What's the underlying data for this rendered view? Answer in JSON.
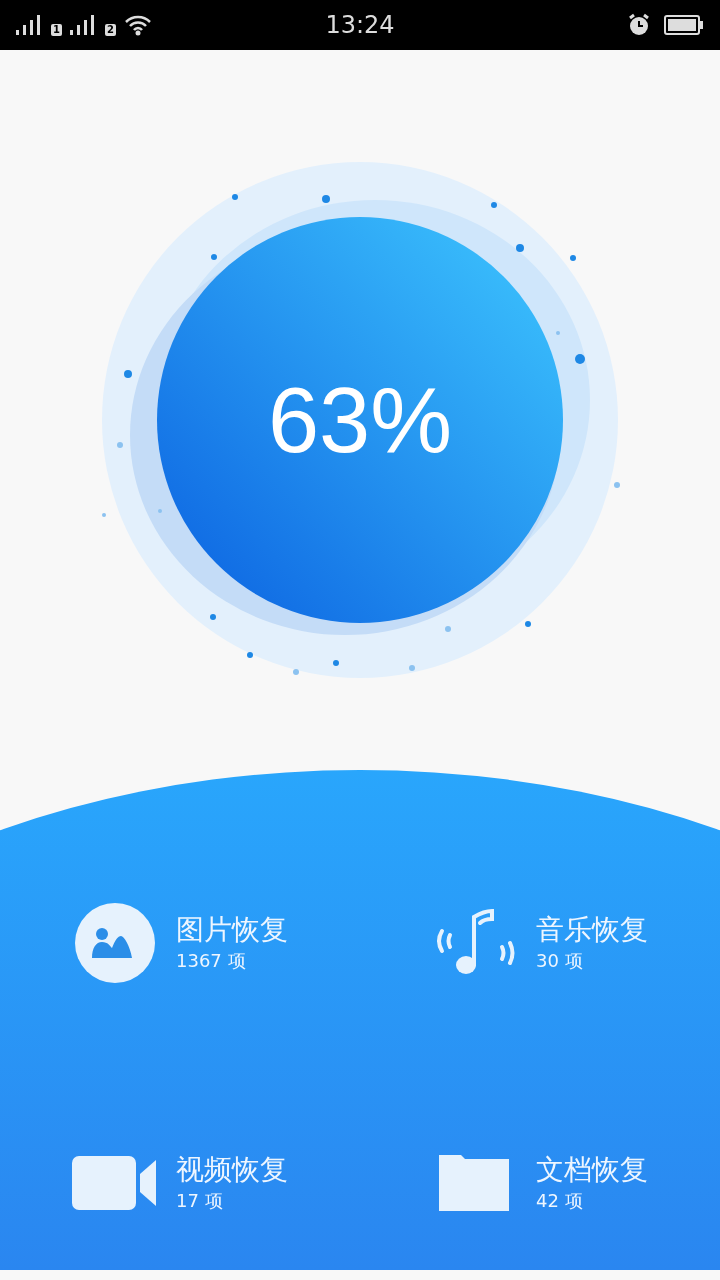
{
  "status_bar": {
    "sims": [
      "1",
      "2"
    ],
    "time": "13:24"
  },
  "scan": {
    "percent": "63%"
  },
  "categories": [
    {
      "kind": "photo",
      "title": "图片恢复",
      "count": "1367 项"
    },
    {
      "kind": "music",
      "title": "音乐恢复",
      "count": "30 项"
    },
    {
      "kind": "video",
      "title": "视频恢复",
      "count": "17 项"
    },
    {
      "kind": "document",
      "title": "文档恢复",
      "count": "42 项"
    }
  ]
}
